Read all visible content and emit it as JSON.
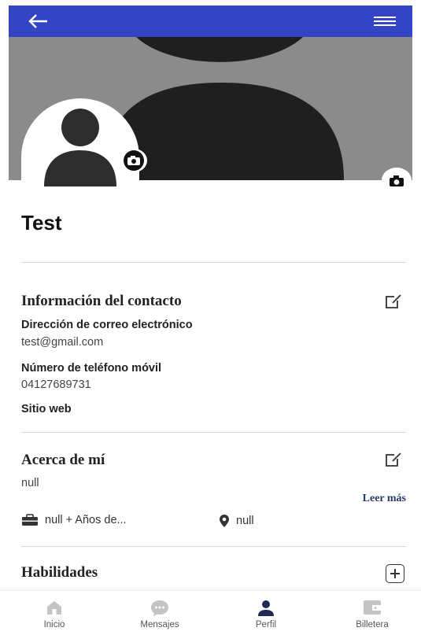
{
  "profile": {
    "name": "Test"
  },
  "contact": {
    "title": "Información del contacto",
    "email_label": "Dirección de correo electrónico",
    "email_value": "test@gmail.com",
    "phone_label": "Número de teléfono móvil",
    "phone_value": "04127689731",
    "website_label": "Sitio web"
  },
  "about": {
    "title": "Acerca de mí",
    "text": "null",
    "read_more": "Leer más",
    "experience": "null + Años de...",
    "location": "null"
  },
  "skills": {
    "title": "Habilidades"
  },
  "nav": {
    "items": [
      {
        "label": "Inicio",
        "icon": "home-icon"
      },
      {
        "label": "Mensajes",
        "icon": "chat-icon"
      },
      {
        "label": "Perfil",
        "icon": "person-icon"
      },
      {
        "label": "Billetera",
        "icon": "wallet-icon"
      }
    ],
    "active_index": 2
  },
  "colors": {
    "header": "#3344c4",
    "cover": "#8b8b8b",
    "link": "#27386d",
    "active_nav": "#1e2a52"
  }
}
